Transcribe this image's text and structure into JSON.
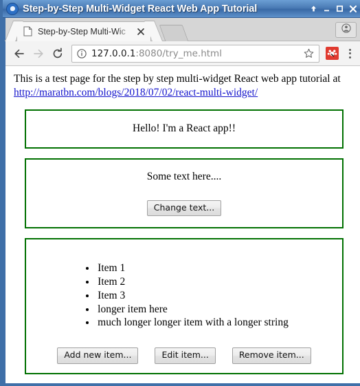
{
  "window": {
    "title": "Step-by-Step Multi-Widget React Web App Tutorial",
    "logo_icon": "chrome-logo-icon",
    "controls": [
      {
        "name": "shade-button",
        "icon": "arrow-up-icon",
        "label": "↑"
      },
      {
        "name": "minimize-button",
        "icon": "minimize-icon",
        "label": "–"
      },
      {
        "name": "maximize-button",
        "icon": "maximize-icon",
        "label": "☐"
      },
      {
        "name": "close-button",
        "icon": "close-icon",
        "label": "✕"
      }
    ],
    "frame_color": "#3f6fa8"
  },
  "tabstrip": {
    "tab": {
      "title": "Step-by-Step Multi-Wic",
      "favicon": "page-icon",
      "close_label": "✕"
    },
    "new_tab_label": "",
    "profile_icon": "account-avatar-icon"
  },
  "toolbar": {
    "back_label": "←",
    "forward_label": "→",
    "reload_label": "↻",
    "info_icon": "info-circle-icon",
    "url_host": "127.0.0.1",
    "url_rest": ":8080/try_me.html",
    "url_full": "127.0.0.1:8080/try_me.html",
    "star_label": "☆",
    "extension_icon": "extension-red-icon",
    "extension_color": "#e03a2f",
    "menu_label": "⋮"
  },
  "page": {
    "intro_text": "This is a test page for the step by step multi-widget React web app tutorial at ",
    "intro_link_text": "http://maratbn.com/blogs/2018/07/02/react-multi-widget/",
    "link_color": "#1414cc",
    "widget_border_color": "#007000",
    "widget_hello": {
      "text": "Hello! I'm a React app!!"
    },
    "widget_text": {
      "text": "Some text here....",
      "button_label": "Change text..."
    },
    "widget_list": {
      "items": [
        "Item 1",
        "Item 2",
        "Item 3",
        "longer item here",
        "much longer longer item with a longer string"
      ],
      "buttons": [
        "Add new item...",
        "Edit item...",
        "Remove item..."
      ]
    }
  }
}
